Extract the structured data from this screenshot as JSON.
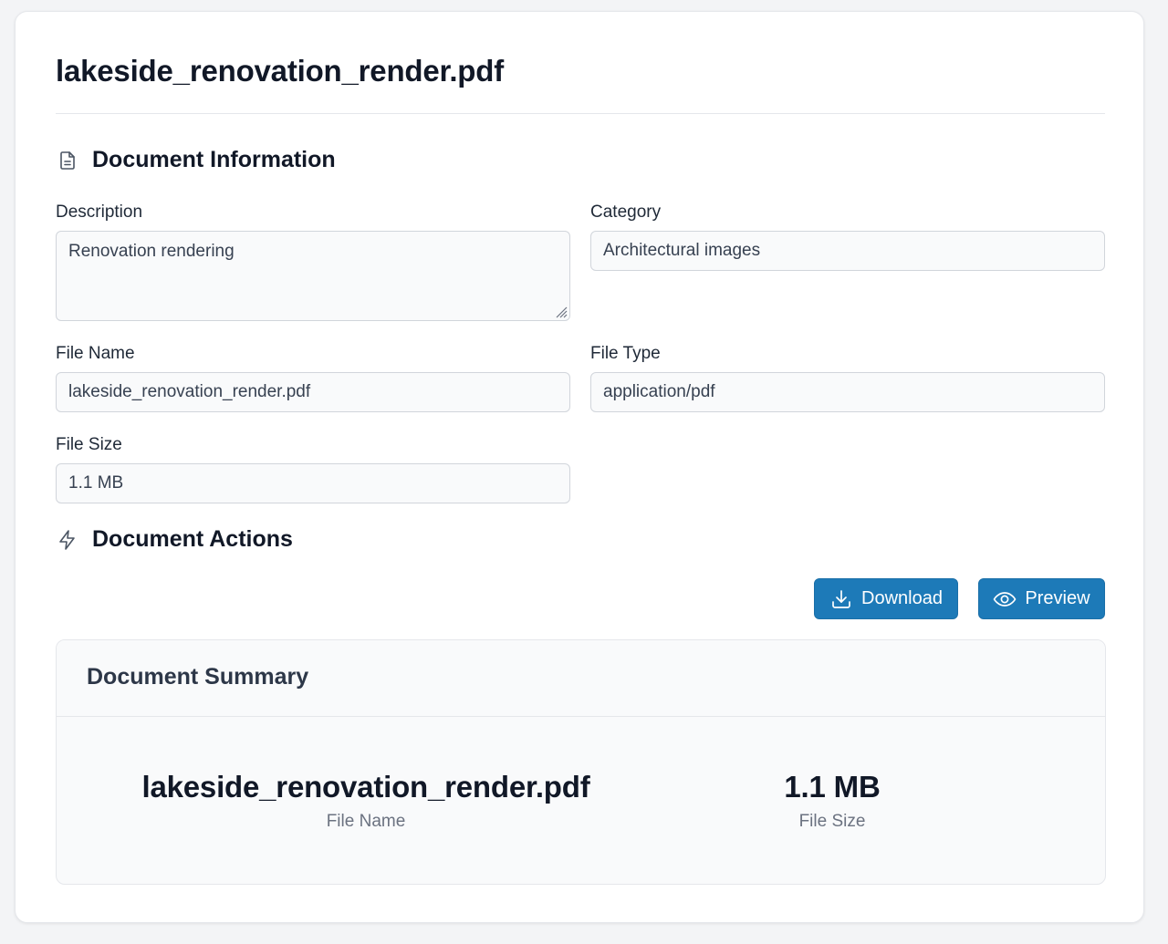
{
  "page": {
    "title": "lakeside_renovation_render.pdf"
  },
  "sections": {
    "info_title": "Document Information",
    "info_icon": "document-icon",
    "actions_title": "Document Actions",
    "actions_icon": "lightning-icon"
  },
  "fields": {
    "description": {
      "label": "Description",
      "value": "Renovation rendering"
    },
    "category": {
      "label": "Category",
      "value": "Architectural images"
    },
    "file_name": {
      "label": "File Name",
      "value": "lakeside_renovation_render.pdf"
    },
    "file_type": {
      "label": "File Type",
      "value": "application/pdf"
    },
    "file_size": {
      "label": "File Size",
      "value": "1.1 MB"
    }
  },
  "actions": {
    "download_label": "Download",
    "download_icon": "download-icon",
    "preview_label": "Preview",
    "preview_icon": "eye-icon"
  },
  "summary": {
    "title": "Document Summary",
    "file_name_value": "lakeside_renovation_render.pdf",
    "file_name_label": "File Name",
    "file_size_value": "1.1 MB",
    "file_size_label": "File Size"
  },
  "colors": {
    "accent": "#1d7ab8",
    "background": "#f3f4f6",
    "card": "#ffffff",
    "input_bg": "#f9fafb",
    "border": "#d1d5db"
  }
}
